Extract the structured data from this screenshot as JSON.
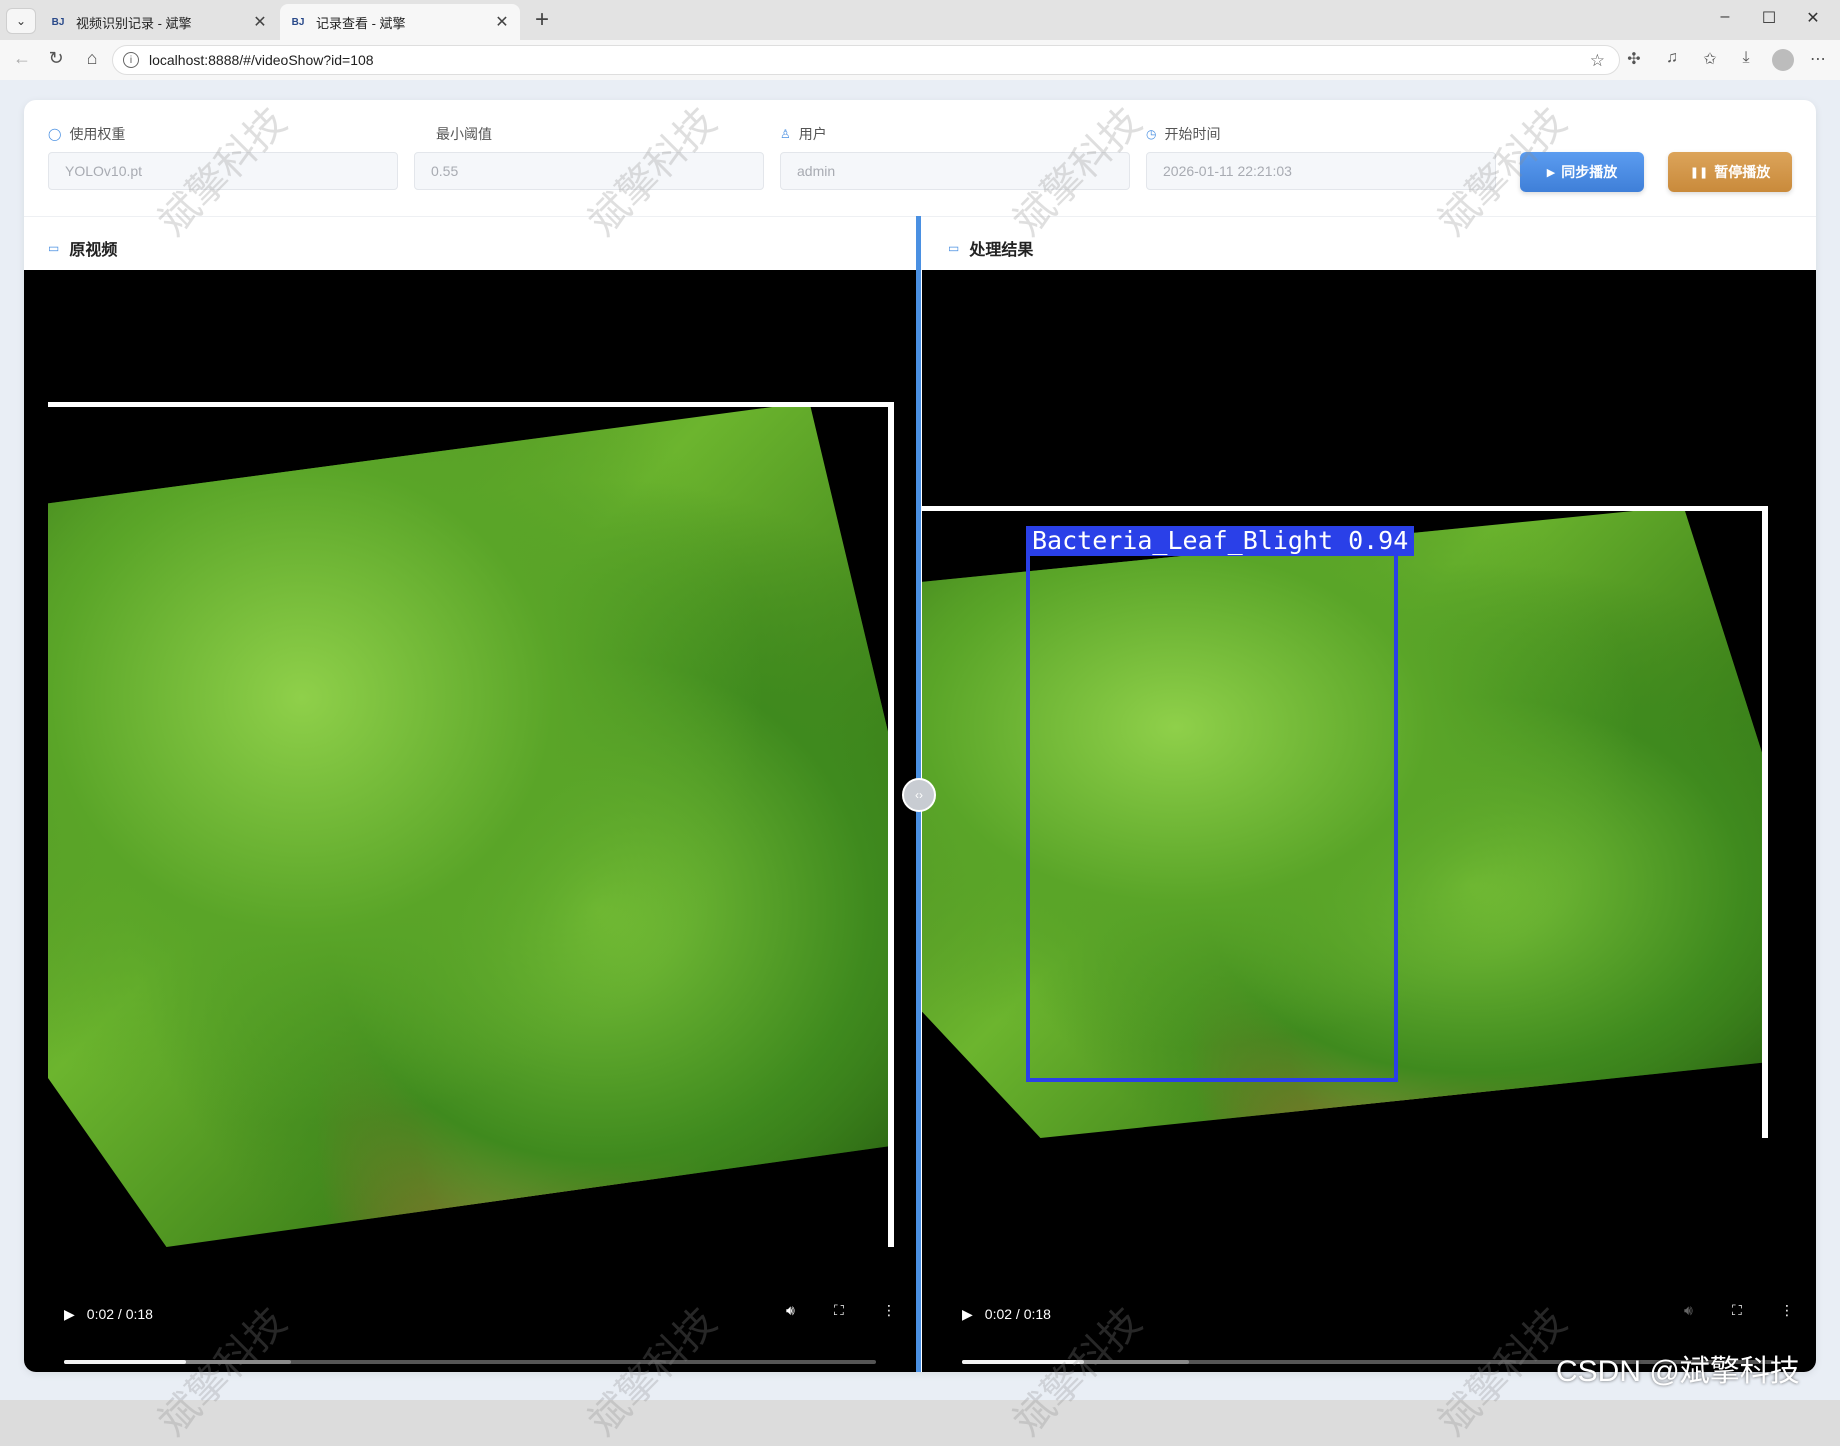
{
  "browser": {
    "tabs": [
      {
        "label": "视频识别记录 - 斌擎",
        "favicon": "BJ"
      },
      {
        "label": "记录查看 - 斌擎",
        "favicon": "BJ"
      }
    ],
    "url": "localhost:8888/#/videoShow?id=108",
    "icons": {
      "menu": "chevron-down-icon",
      "close": "close-icon",
      "new_tab": "plus-icon",
      "minimize": "minimize-icon",
      "maximize": "maximize-icon",
      "window_close": "close-icon",
      "back": "back-arrow-icon",
      "reload": "reload-icon",
      "home": "home-icon",
      "info": "info-icon",
      "star": "star-icon",
      "extensions": "puzzle-icon",
      "music": "media-icon",
      "favorites": "favorites-icon",
      "download": "download-icon",
      "more": "more-icon"
    }
  },
  "form": {
    "weights": {
      "label": "使用权重",
      "value": "YOLOv10.pt"
    },
    "threshold": {
      "label": "最小阈值",
      "value": "0.55"
    },
    "user": {
      "label": "用户",
      "value": "admin"
    },
    "start_time": {
      "label": "开始时间",
      "value": "2026-01-11 22:21:03"
    }
  },
  "buttons": {
    "sync_play": "同步播放",
    "pause": "暂停播放"
  },
  "panels": {
    "original": "原视频",
    "result": "处理结果"
  },
  "video_left": {
    "time": "0:02 / 0:18",
    "progress": 0.15,
    "buffered": 0.28
  },
  "video_right": {
    "time": "0:02 / 0:18",
    "progress": 0.15,
    "buffered": 0.28
  },
  "detection": {
    "label": "Bacteria_Leaf_Blight 0.94"
  },
  "watermark": "斌擎科技",
  "credit": "CSDN @斌擎科技",
  "colors": {
    "accent": "#4a90e2",
    "play_button": "#3f7fd8",
    "pause_button": "#c98a3b",
    "bbox": "#2a40e8"
  }
}
